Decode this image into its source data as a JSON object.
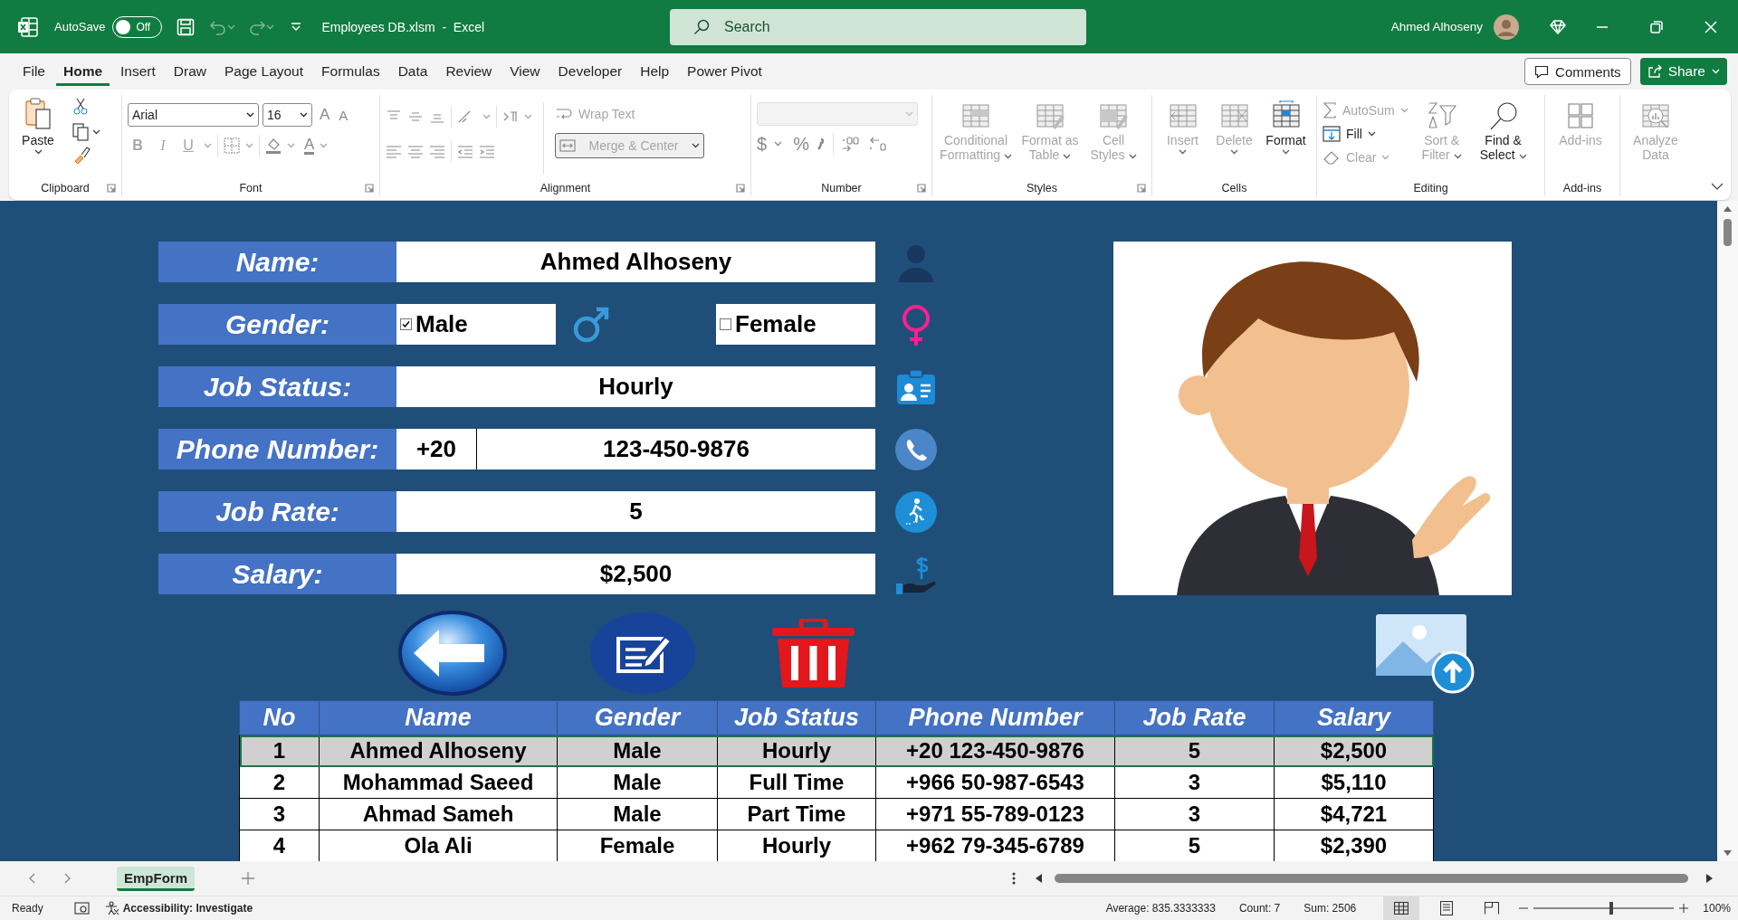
{
  "title_bar": {
    "autosave_label": "AutoSave",
    "autosave_on": false,
    "autosave_state": "Off",
    "document_title": "Employees DB.xlsm  -  Excel",
    "search_placeholder": "Search",
    "user_name": "Ahmed Alhoseny"
  },
  "menu_tabs": [
    {
      "label": "File",
      "selected": false
    },
    {
      "label": "Home",
      "selected": true
    },
    {
      "label": "Insert",
      "selected": false
    },
    {
      "label": "Draw",
      "selected": false
    },
    {
      "label": "Page Layout",
      "selected": false
    },
    {
      "label": "Formulas",
      "selected": false
    },
    {
      "label": "Data",
      "selected": false
    },
    {
      "label": "Review",
      "selected": false
    },
    {
      "label": "View",
      "selected": false
    },
    {
      "label": "Developer",
      "selected": false
    },
    {
      "label": "Help",
      "selected": false
    },
    {
      "label": "Power Pivot",
      "selected": false
    }
  ],
  "comments_button": "Comments",
  "share_button": "Share",
  "ribbon": {
    "clipboard": {
      "label": "Clipboard",
      "paste": "Paste"
    },
    "font": {
      "label": "Font",
      "name": "Arial",
      "size": "16",
      "grow_label": "A",
      "shrink_label": "A",
      "font_color_label": "A",
      "format_buttons": [
        {
          "label": "B",
          "disabled": true
        },
        {
          "label": "I",
          "disabled": true
        },
        {
          "label": "U",
          "disabled": true
        }
      ]
    },
    "alignment": {
      "label": "Alignment",
      "commands": [
        {
          "label": "Wrap Text",
          "disabled": true
        },
        {
          "label": "Merge & Center",
          "disabled": true
        }
      ]
    },
    "number": {
      "label": "Number",
      "currency": "$",
      "percent": "%"
    },
    "styles": {
      "label": "Styles",
      "commands": [
        {
          "label": "Conditional Formatting",
          "disabled": true
        },
        {
          "label": "Format as Table",
          "disabled": true
        },
        {
          "label": "Cell Styles",
          "disabled": true
        }
      ]
    },
    "cells": {
      "label": "Cells",
      "commands": [
        {
          "label": "Insert",
          "disabled": true
        },
        {
          "label": "Delete",
          "disabled": true
        },
        {
          "label": "Format",
          "disabled": false
        }
      ]
    },
    "editing": {
      "label": "Editing",
      "commands": [
        {
          "label": "AutoSum",
          "disabled": true
        },
        {
          "label": "Fill",
          "disabled": false
        },
        {
          "label": "Clear",
          "disabled": true
        },
        {
          "label": "Sort & Filter",
          "disabled": true
        },
        {
          "label": "Find & Select",
          "disabled": false
        }
      ]
    },
    "addins": {
      "label": "Add-ins",
      "commands": [
        {
          "label": "Add-ins",
          "disabled": true
        }
      ]
    },
    "analyze": {
      "commands": [
        {
          "label": "Analyze Data",
          "disabled": true
        }
      ]
    }
  },
  "form": {
    "fields": [
      {
        "kind": "text",
        "label": "Name:",
        "value": "Ahmed Alhoseny"
      },
      {
        "kind": "gender",
        "label": "Gender:",
        "options": [
          {
            "label": "Male",
            "checked": true
          },
          {
            "label": "Female",
            "checked": false
          }
        ]
      },
      {
        "kind": "text",
        "label": "Job Status:",
        "value": "Hourly"
      },
      {
        "kind": "phone",
        "label": "Phone Number:",
        "code": "+20",
        "value": "123-450-9876"
      },
      {
        "kind": "text",
        "label": "Job Rate:",
        "value": "5"
      },
      {
        "kind": "text",
        "label": "Salary:",
        "value": "$2,500"
      }
    ]
  },
  "table": {
    "columns": [
      "No",
      "Name",
      "Gender",
      "Job Status",
      "Phone Number",
      "Job Rate",
      "Salary"
    ],
    "rows": [
      {
        "selected": true,
        "cells": [
          "1",
          "Ahmed Alhoseny",
          "Male",
          "Hourly",
          "+20 123-450-9876",
          "5",
          "$2,500"
        ]
      },
      {
        "selected": false,
        "cells": [
          "2",
          "Mohammad Saeed",
          "Male",
          "Full Time",
          "+966 50-987-6543",
          "3",
          "$5,110"
        ]
      },
      {
        "selected": false,
        "cells": [
          "3",
          "Ahmad Sameh",
          "Male",
          "Part Time",
          "+971 55-789-0123",
          "3",
          "$4,721"
        ]
      },
      {
        "selected": false,
        "cells": [
          "4",
          "Ola Ali",
          "Female",
          "Hourly",
          "+962 79-345-6789",
          "5",
          "$2,390"
        ]
      }
    ]
  },
  "sheet_tabs": [
    {
      "label": "EmpForm",
      "selected": true
    }
  ],
  "status_bar": {
    "ready": "Ready",
    "accessibility": "Accessibility: Investigate",
    "average": "Average: 835.3333333",
    "count": "Count: 7",
    "sum": "Sum: 2506",
    "zoom_slider": {
      "level": 0.55
    },
    "zoom": "100%"
  }
}
